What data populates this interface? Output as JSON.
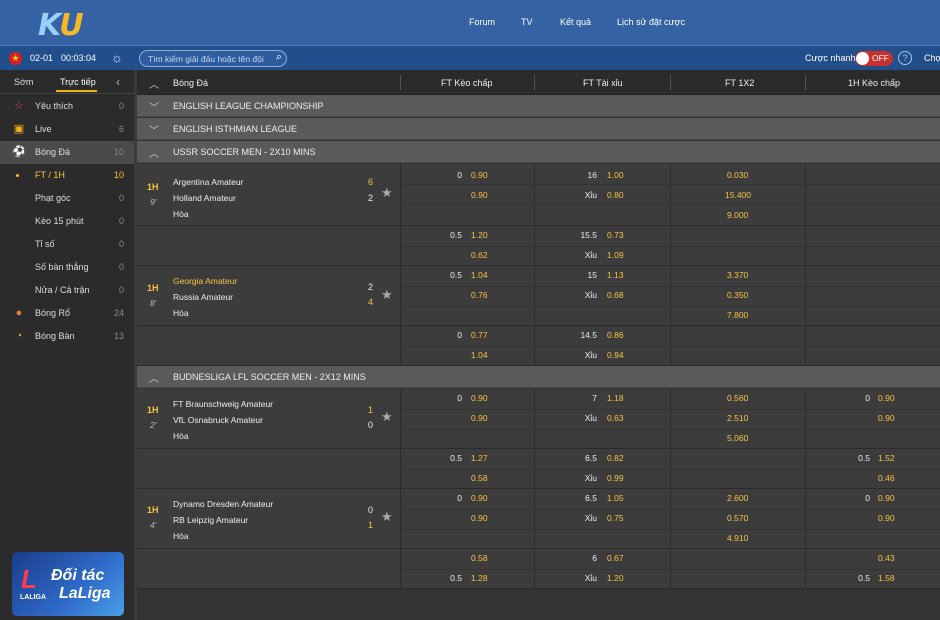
{
  "header": {
    "logo_k": "K",
    "logo_u": "U",
    "nav": [
      "Forum",
      "TV",
      "Kết quả",
      "Lịch sử đặt cược"
    ]
  },
  "subbar": {
    "date": "02-01",
    "clock": "00:03:04",
    "search_placeholder": "Tìm kiếm giải đấu hoặc tên đội",
    "quick_bet_label": "Cược nhanh",
    "toggle_state": "OFF",
    "help": "?",
    "extra": "Chọ"
  },
  "sidebar": {
    "tabs": [
      "Sớm",
      "Trực tiếp"
    ],
    "items": [
      {
        "label": "Yêu thích",
        "count": "0",
        "icon": "star-icon"
      },
      {
        "label": "Live",
        "count": "6",
        "icon": "tv-icon"
      },
      {
        "label": "Bóng Đá",
        "count": "10",
        "icon": "soccer-ball-icon"
      },
      {
        "label": "FT / 1H",
        "count": "10"
      },
      {
        "label": "Phạt góc",
        "count": "0"
      },
      {
        "label": "Kèo 15 phút",
        "count": "0"
      },
      {
        "label": "Tỉ số",
        "count": "0"
      },
      {
        "label": "Số bàn thắng",
        "count": "0"
      },
      {
        "label": "Nửa / Cả trận",
        "count": "0"
      },
      {
        "label": "Bóng Rổ",
        "count": "24",
        "icon": "basketball-icon"
      },
      {
        "label": "Bóng Bàn",
        "count": "13",
        "icon": "table-tennis-icon"
      }
    ],
    "banner": {
      "logo_text": "LALIGA",
      "line1": "Đối tác",
      "line2": "LaLiga"
    }
  },
  "columns": {
    "sport": "Bóng Đá",
    "ft_handicap": "FT Kèo chấp",
    "ft_overunder": "FT Tài xỉu",
    "ft_1x2": "FT 1X2",
    "h1_handicap": "1H Kèo chấp"
  },
  "leagues": [
    "ENGLISH LEAGUE CHAMPIONSHIP",
    "ENGLISH ISTHMIAN LEAGUE",
    "USSR SOCCER MEN - 2X10 MINS",
    "BUDNESLIGA LFL SOCCER MEN - 2X12 MINS"
  ],
  "matches": [
    {
      "half": "1H",
      "minute": "9'",
      "home": "Argentina Amateur",
      "away": "Holland Amateur",
      "draw": "Hòa",
      "home_score": "6",
      "away_score": "2",
      "ft_hc": [
        "0",
        "0.90",
        "",
        "0.90"
      ],
      "ft_ou": [
        "16",
        "1.00",
        "Xỉu",
        "0.80"
      ],
      "x12": [
        "0.030",
        "15.400",
        "9.000"
      ],
      "h1": [
        "",
        "",
        "",
        ""
      ],
      "line2": {
        "ft_hc": [
          "0.5",
          "1.20",
          "",
          "0.62"
        ],
        "ft_ou": [
          "15.5",
          "0.73",
          "Xỉu",
          "1.09"
        ],
        "h1": [
          "",
          "",
          "",
          ""
        ]
      }
    },
    {
      "half": "1H",
      "minute": "8'",
      "home": "Georgia Amateur",
      "away": "Russia Amateur",
      "draw": "Hòa",
      "home_score": "2",
      "away_score": "4",
      "ft_hc": [
        "0.5",
        "1.04",
        "",
        "0.76"
      ],
      "ft_ou": [
        "15",
        "1.13",
        "Xỉu",
        "0.68"
      ],
      "x12": [
        "3.370",
        "0.350",
        "7.800"
      ],
      "h1": [
        "",
        "",
        "",
        ""
      ],
      "line2": {
        "ft_hc": [
          "0",
          "0.77",
          "",
          "1.04"
        ],
        "ft_ou": [
          "14.5",
          "0.86",
          "Xỉu",
          "0.94"
        ],
        "h1": [
          "",
          "",
          "",
          ""
        ]
      }
    },
    {
      "half": "1H",
      "minute": "2'",
      "home": "FT Braunschweig Amateur",
      "away": "VfL Osnabruck Amateur",
      "draw": "Hòa",
      "home_score": "1",
      "away_score": "0",
      "ft_hc": [
        "0",
        "0.90",
        "",
        "0.90"
      ],
      "ft_ou": [
        "7",
        "1.18",
        "Xỉu",
        "0.63"
      ],
      "x12": [
        "0.560",
        "2.510",
        "5.060"
      ],
      "h1": [
        "0",
        "0.90",
        "",
        "0.90"
      ],
      "line2": {
        "ft_hc": [
          "0.5",
          "1.27",
          "",
          "0.58"
        ],
        "ft_ou": [
          "6.5",
          "0.82",
          "Xỉu",
          "0.99"
        ],
        "h1": [
          "0.5",
          "1.52",
          "",
          "0.46"
        ]
      }
    },
    {
      "half": "1H",
      "minute": "4'",
      "home": "Dynamo Dresden Amateur",
      "away": "RB Leipzig Amateur",
      "draw": "Hòa",
      "home_score": "0",
      "away_score": "1",
      "ft_hc": [
        "0",
        "0.90",
        "",
        "0.90"
      ],
      "ft_ou": [
        "6.5",
        "1.05",
        "Xỉu",
        "0.75"
      ],
      "x12": [
        "2.600",
        "0.570",
        "4.910"
      ],
      "h1": [
        "0",
        "0.90",
        "",
        "0.90"
      ],
      "line2": {
        "ft_hc": [
          "",
          "0.58",
          "0.5",
          "1.28"
        ],
        "ft_ou": [
          "6",
          "0.67",
          "Xỉu",
          "1.20"
        ],
        "h1": [
          "",
          "0.43",
          "0.5",
          "1.58"
        ]
      }
    }
  ],
  "colors": {
    "header": "#3462a3",
    "subbar": "#214f8c",
    "accent": "#f6c342",
    "toggle": "#c9302c"
  }
}
